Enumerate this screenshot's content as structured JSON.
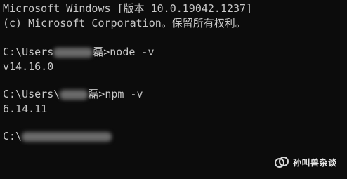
{
  "terminal": {
    "header_line1": "Microsoft Windows [版本 10.0.19042.1237]",
    "header_line2": "(c) Microsoft Corporation。保留所有权利。",
    "session": [
      {
        "prompt_prefix": "C:\\Users",
        "prompt_suffix": "磊>",
        "command": "node -v",
        "output": "v14.16.0"
      },
      {
        "prompt_prefix": "C:\\Users\\",
        "prompt_suffix": "磊>",
        "command": "npm -v",
        "output": "6.14.11"
      }
    ],
    "current_prompt_prefix": "C:\\"
  },
  "watermark": {
    "text": "孙叫兽杂谈",
    "icon": "wechat-channel-logo"
  }
}
